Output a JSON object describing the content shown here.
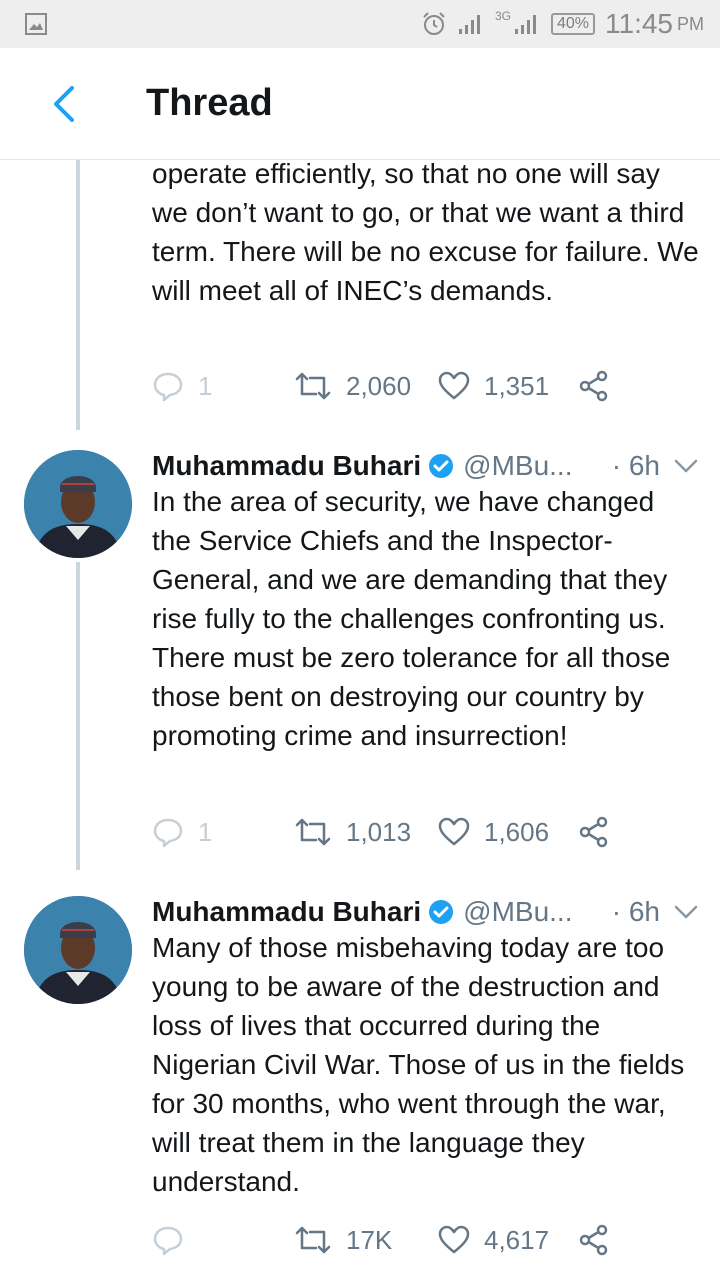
{
  "status_bar": {
    "network_type": "3G",
    "battery": "40%",
    "time": "11:45",
    "ampm": "PM"
  },
  "header": {
    "title": "Thread"
  },
  "tweets": [
    {
      "name": "",
      "handle": "",
      "time": "",
      "text": "operate efficiently, so that no one will say we don’t want to go, or that we want a third term. There will be no excuse for failure. We will meet all of INEC’s demands.",
      "replies": "1",
      "retweets": "2,060",
      "likes": "1,351"
    },
    {
      "name": "Muhammadu Buhari",
      "handle": "@MBu...",
      "time": "· 6h",
      "text": "In the area of security, we have changed the Service Chiefs and the Inspector-General, and we are demanding that they rise fully to the challenges confronting us. There must be zero tolerance for all those those bent on destroying our country by promoting crime and insurrection!",
      "replies": "1",
      "retweets": "1,013",
      "likes": "1,606"
    },
    {
      "name": "Muhammadu Buhari",
      "handle": "@MBu...",
      "time": "· 6h",
      "text": "Many of those misbehaving today are too young to be aware of the destruction and loss of lives that occurred during the Nigerian Civil War. Those of us in the fields for 30 months, who went through the war, will treat them in the language they understand.",
      "replies": "",
      "retweets": "17K",
      "likes": "4,617"
    }
  ],
  "colors": {
    "accent": "#1da1f2",
    "muted": "#657786",
    "thread_line": "#ccd6dd"
  }
}
